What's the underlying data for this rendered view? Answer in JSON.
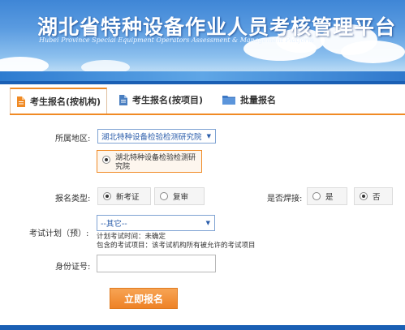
{
  "header": {
    "title": "湖北省特种设备作业人员考核管理平台",
    "subtitle": "Hubei Province Special Equipment Operators Assessment & Management Platform"
  },
  "tabs": [
    {
      "label": "考生报名(按机构)",
      "icon": "document-icon",
      "active": true
    },
    {
      "label": "考生报名(按项目)",
      "icon": "document-icon",
      "active": false
    },
    {
      "label": "批量报名",
      "icon": "folder-icon",
      "active": false
    }
  ],
  "form": {
    "region_label": "所属地区:",
    "region_value": "湖北特种设备检验检测研究院",
    "org_option": "湖北特种设备检验检测研究院",
    "type_label": "报名类型:",
    "type_options": [
      "新考证",
      "复审"
    ],
    "type_selected": "新考证",
    "weld_label": "是否焊接:",
    "weld_options": [
      "是",
      "否"
    ],
    "weld_selected": "否",
    "plan_label": "考试计划（预）:",
    "plan_value": "--其它--",
    "plan_time": "计划考试时间：未确定",
    "plan_items": "包含的考试项目：该考试机构所有被允许的考试项目",
    "id_label": "身份证号:",
    "id_value": "",
    "submit_label": "立即报名"
  },
  "colors": {
    "accent": "#f08a24",
    "brand_blue": "#1a5fb4",
    "link_blue": "#2a5caa"
  }
}
